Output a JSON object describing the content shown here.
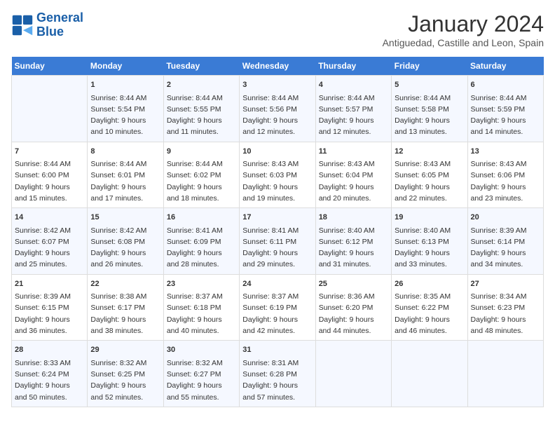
{
  "header": {
    "logo_line1": "General",
    "logo_line2": "Blue",
    "title": "January 2024",
    "subtitle": "Antiguedad, Castille and Leon, Spain"
  },
  "days_of_week": [
    "Sunday",
    "Monday",
    "Tuesday",
    "Wednesday",
    "Thursday",
    "Friday",
    "Saturday"
  ],
  "weeks": [
    [
      {
        "day": "",
        "content": ""
      },
      {
        "day": "1",
        "content": "Sunrise: 8:44 AM\nSunset: 5:54 PM\nDaylight: 9 hours\nand 10 minutes."
      },
      {
        "day": "2",
        "content": "Sunrise: 8:44 AM\nSunset: 5:55 PM\nDaylight: 9 hours\nand 11 minutes."
      },
      {
        "day": "3",
        "content": "Sunrise: 8:44 AM\nSunset: 5:56 PM\nDaylight: 9 hours\nand 12 minutes."
      },
      {
        "day": "4",
        "content": "Sunrise: 8:44 AM\nSunset: 5:57 PM\nDaylight: 9 hours\nand 12 minutes."
      },
      {
        "day": "5",
        "content": "Sunrise: 8:44 AM\nSunset: 5:58 PM\nDaylight: 9 hours\nand 13 minutes."
      },
      {
        "day": "6",
        "content": "Sunrise: 8:44 AM\nSunset: 5:59 PM\nDaylight: 9 hours\nand 14 minutes."
      }
    ],
    [
      {
        "day": "7",
        "content": "Sunrise: 8:44 AM\nSunset: 6:00 PM\nDaylight: 9 hours\nand 15 minutes."
      },
      {
        "day": "8",
        "content": "Sunrise: 8:44 AM\nSunset: 6:01 PM\nDaylight: 9 hours\nand 17 minutes."
      },
      {
        "day": "9",
        "content": "Sunrise: 8:44 AM\nSunset: 6:02 PM\nDaylight: 9 hours\nand 18 minutes."
      },
      {
        "day": "10",
        "content": "Sunrise: 8:43 AM\nSunset: 6:03 PM\nDaylight: 9 hours\nand 19 minutes."
      },
      {
        "day": "11",
        "content": "Sunrise: 8:43 AM\nSunset: 6:04 PM\nDaylight: 9 hours\nand 20 minutes."
      },
      {
        "day": "12",
        "content": "Sunrise: 8:43 AM\nSunset: 6:05 PM\nDaylight: 9 hours\nand 22 minutes."
      },
      {
        "day": "13",
        "content": "Sunrise: 8:43 AM\nSunset: 6:06 PM\nDaylight: 9 hours\nand 23 minutes."
      }
    ],
    [
      {
        "day": "14",
        "content": "Sunrise: 8:42 AM\nSunset: 6:07 PM\nDaylight: 9 hours\nand 25 minutes."
      },
      {
        "day": "15",
        "content": "Sunrise: 8:42 AM\nSunset: 6:08 PM\nDaylight: 9 hours\nand 26 minutes."
      },
      {
        "day": "16",
        "content": "Sunrise: 8:41 AM\nSunset: 6:09 PM\nDaylight: 9 hours\nand 28 minutes."
      },
      {
        "day": "17",
        "content": "Sunrise: 8:41 AM\nSunset: 6:11 PM\nDaylight: 9 hours\nand 29 minutes."
      },
      {
        "day": "18",
        "content": "Sunrise: 8:40 AM\nSunset: 6:12 PM\nDaylight: 9 hours\nand 31 minutes."
      },
      {
        "day": "19",
        "content": "Sunrise: 8:40 AM\nSunset: 6:13 PM\nDaylight: 9 hours\nand 33 minutes."
      },
      {
        "day": "20",
        "content": "Sunrise: 8:39 AM\nSunset: 6:14 PM\nDaylight: 9 hours\nand 34 minutes."
      }
    ],
    [
      {
        "day": "21",
        "content": "Sunrise: 8:39 AM\nSunset: 6:15 PM\nDaylight: 9 hours\nand 36 minutes."
      },
      {
        "day": "22",
        "content": "Sunrise: 8:38 AM\nSunset: 6:17 PM\nDaylight: 9 hours\nand 38 minutes."
      },
      {
        "day": "23",
        "content": "Sunrise: 8:37 AM\nSunset: 6:18 PM\nDaylight: 9 hours\nand 40 minutes."
      },
      {
        "day": "24",
        "content": "Sunrise: 8:37 AM\nSunset: 6:19 PM\nDaylight: 9 hours\nand 42 minutes."
      },
      {
        "day": "25",
        "content": "Sunrise: 8:36 AM\nSunset: 6:20 PM\nDaylight: 9 hours\nand 44 minutes."
      },
      {
        "day": "26",
        "content": "Sunrise: 8:35 AM\nSunset: 6:22 PM\nDaylight: 9 hours\nand 46 minutes."
      },
      {
        "day": "27",
        "content": "Sunrise: 8:34 AM\nSunset: 6:23 PM\nDaylight: 9 hours\nand 48 minutes."
      }
    ],
    [
      {
        "day": "28",
        "content": "Sunrise: 8:33 AM\nSunset: 6:24 PM\nDaylight: 9 hours\nand 50 minutes."
      },
      {
        "day": "29",
        "content": "Sunrise: 8:32 AM\nSunset: 6:25 PM\nDaylight: 9 hours\nand 52 minutes."
      },
      {
        "day": "30",
        "content": "Sunrise: 8:32 AM\nSunset: 6:27 PM\nDaylight: 9 hours\nand 55 minutes."
      },
      {
        "day": "31",
        "content": "Sunrise: 8:31 AM\nSunset: 6:28 PM\nDaylight: 9 hours\nand 57 minutes."
      },
      {
        "day": "",
        "content": ""
      },
      {
        "day": "",
        "content": ""
      },
      {
        "day": "",
        "content": ""
      }
    ]
  ]
}
